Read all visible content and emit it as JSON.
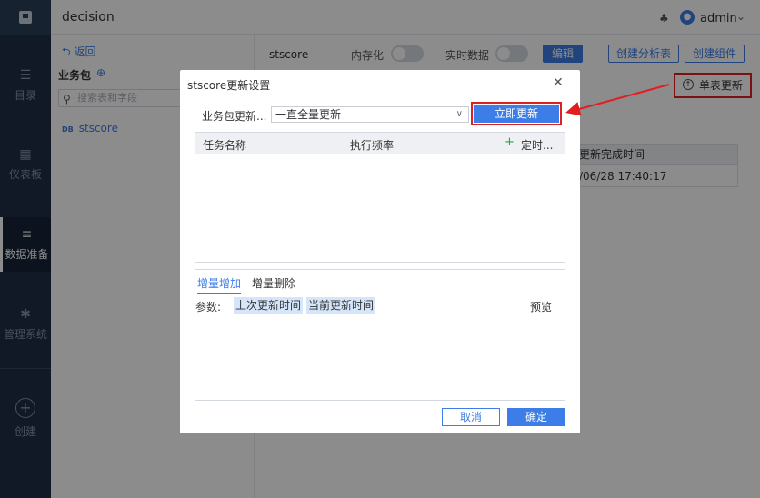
{
  "app": {
    "title": "decision"
  },
  "topbar": {
    "user": "admin"
  },
  "nav": {
    "items": [
      {
        "label": "目录",
        "icon": "list-icon"
      },
      {
        "label": "仪表板",
        "icon": "dashboard-icon"
      },
      {
        "label": "数据准备",
        "icon": "database-icon"
      },
      {
        "label": "管理系统",
        "icon": "gear-icon"
      }
    ],
    "create_label": "创建"
  },
  "side_panel": {
    "back_label": "返回",
    "package_title": "业务包",
    "search_placeholder": "搜索表和字段",
    "table_item": "stscore",
    "table_tag": "DB"
  },
  "main": {
    "table_name": "stscore",
    "in_memory_label": "内存化",
    "realtime_label": "实时数据",
    "edit_button": "编辑",
    "create_analysis_button": "创建分析表",
    "create_component_button": "创建组件",
    "single_update_button": "单表更新",
    "column_header": "更新完成时间",
    "column_value": "/06/28 17:40:17"
  },
  "dialog": {
    "title": "stscore更新设置",
    "package_update_label": "业务包更新...",
    "update_mode_value": "一直全量更新",
    "update_now_button": "立即更新",
    "task_table": {
      "headers": [
        "任务名称",
        "执行频率",
        "定时..."
      ]
    },
    "tabs": [
      "增量增加",
      "增量删除"
    ],
    "params_label": "参数:",
    "param_chips": [
      "上次更新时间",
      "当前更新时间"
    ],
    "preview_label": "预览",
    "cancel_button": "取消",
    "ok_button": "确定"
  },
  "colors": {
    "accent": "#3d7de7",
    "nav_bg": "#1f2f45",
    "highlight_red": "#e02020"
  }
}
